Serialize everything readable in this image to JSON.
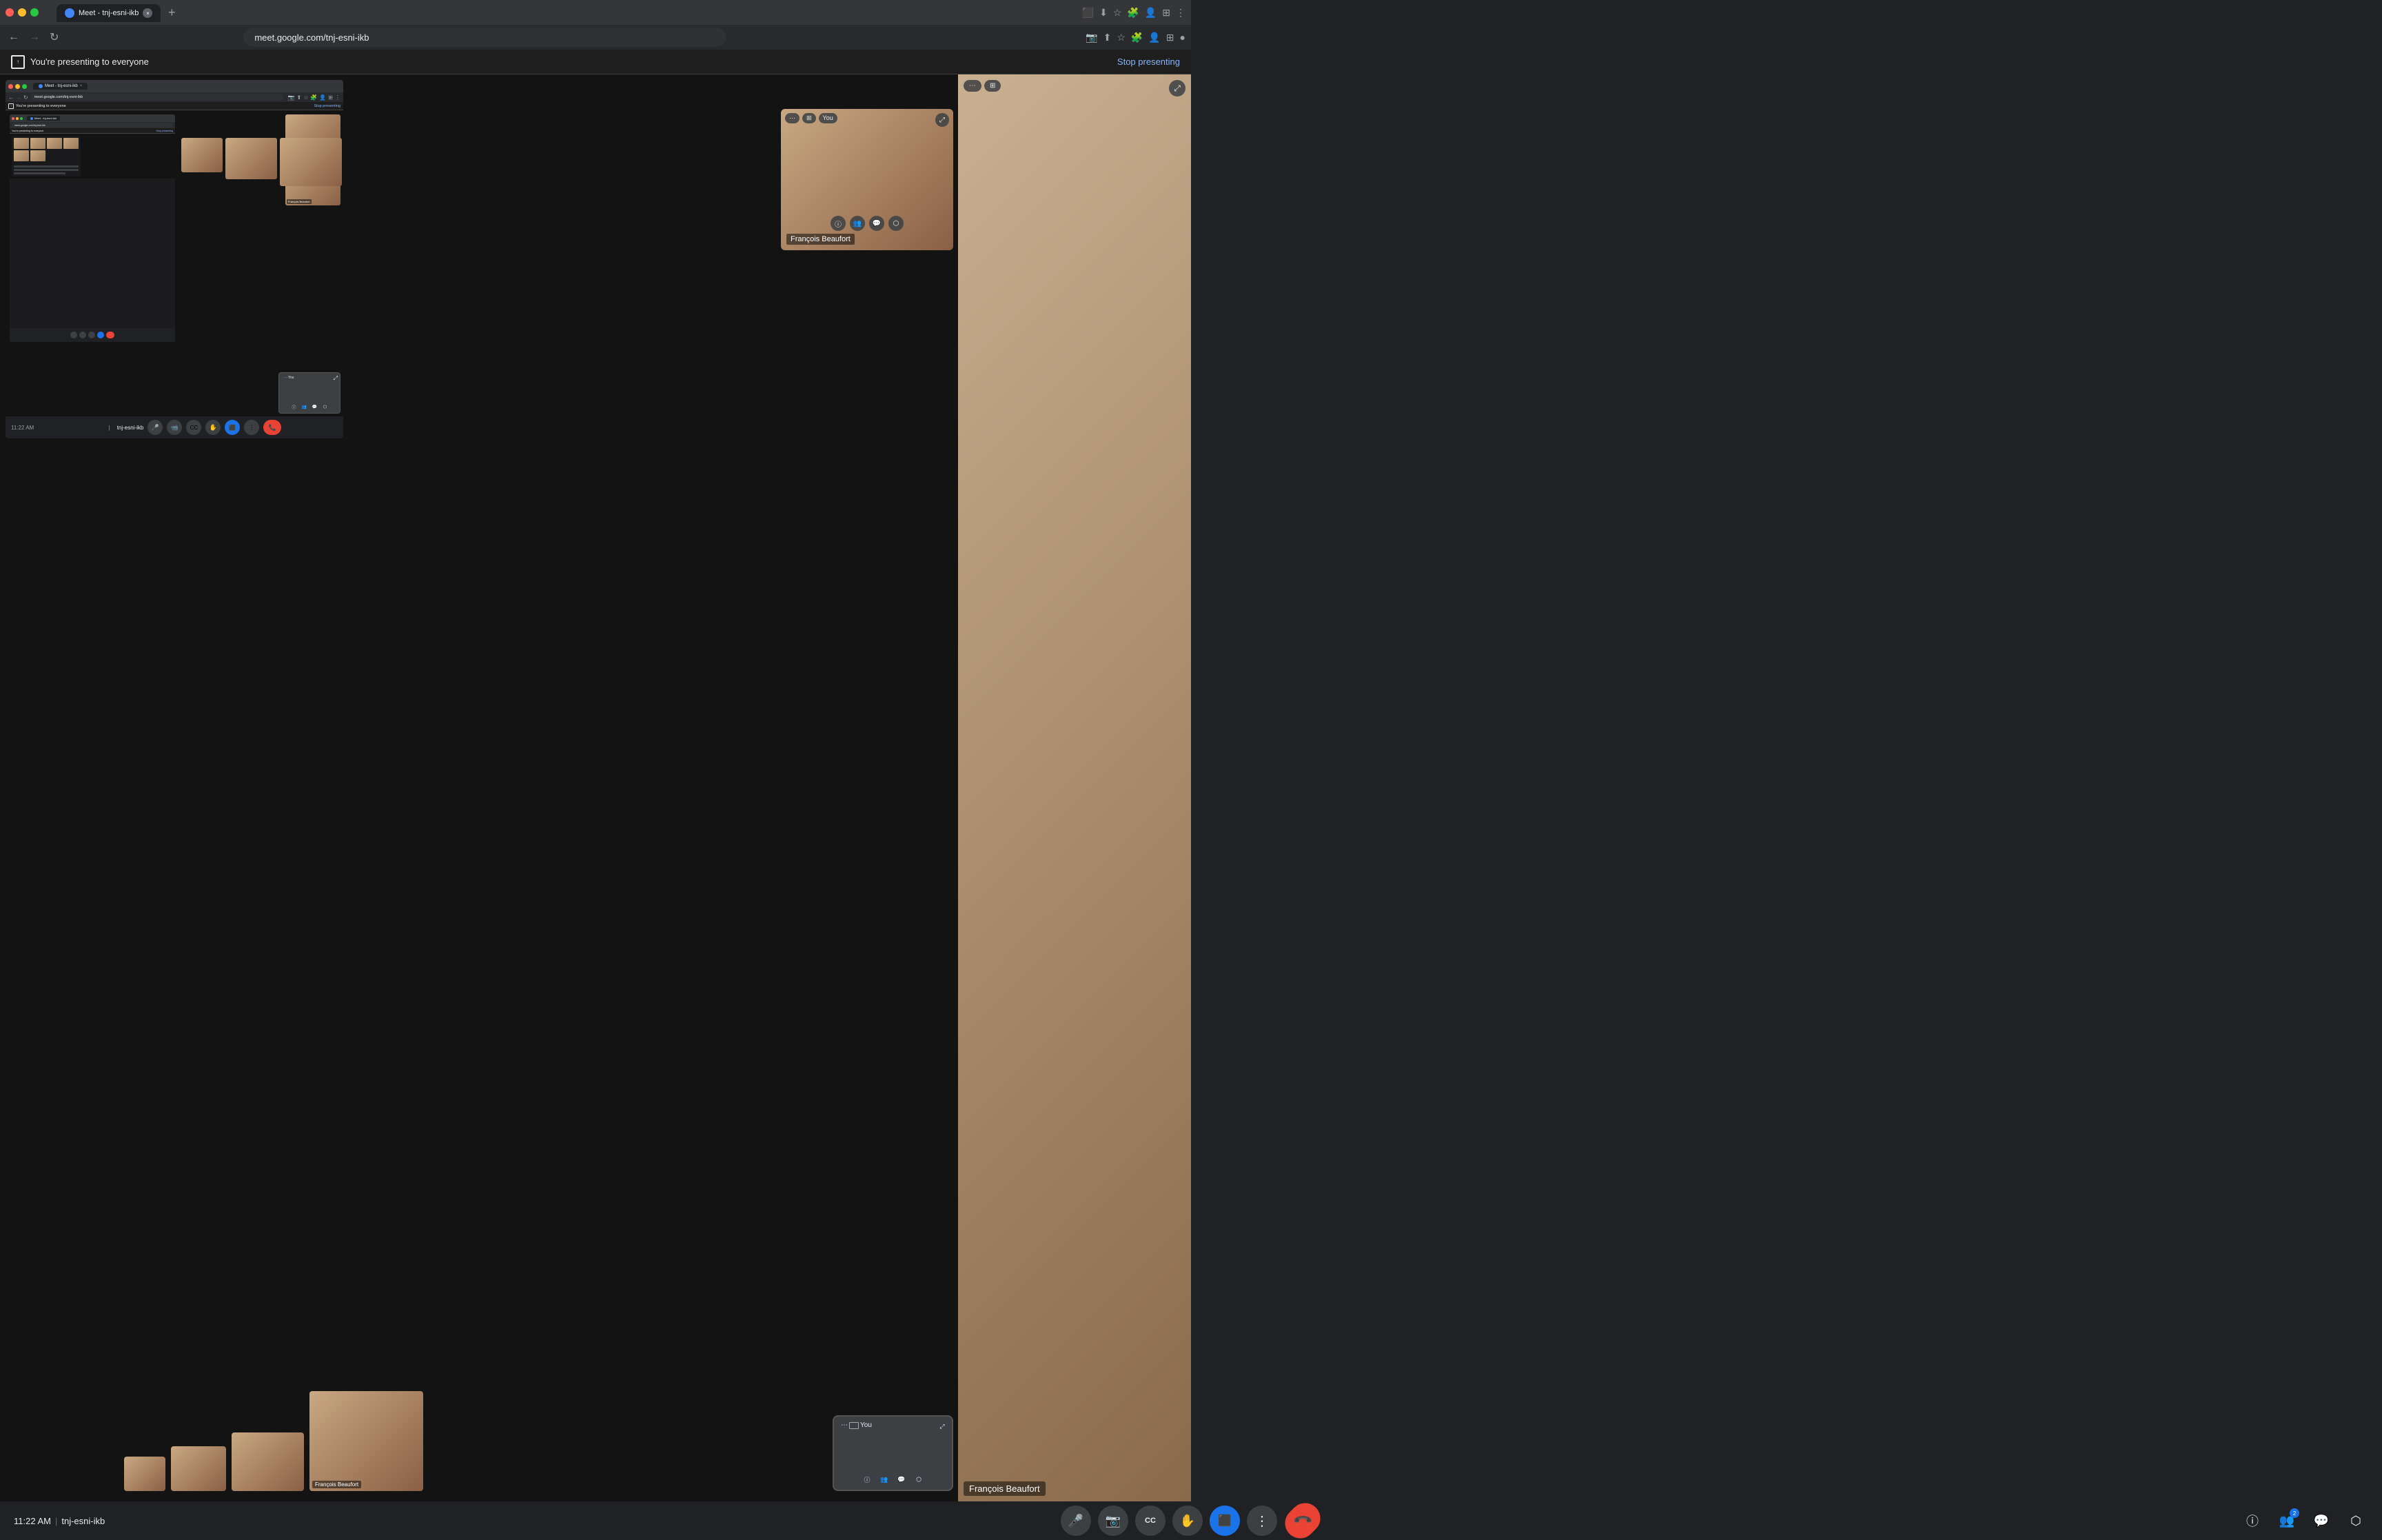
{
  "browser": {
    "tab_title": "Meet - tnj-esni-ikb",
    "tab_new_label": "+",
    "url": "meet.google.com/tnj-esni-ikb",
    "nav_back": "←",
    "nav_forward": "→",
    "nav_reload": "↻"
  },
  "presenting_banner": {
    "icon": "⬛",
    "text": "You're presenting to everyone",
    "stop_btn": "Stop presenting"
  },
  "nested_browser": {
    "tab_title": "Meet - tnj-esni-ikb",
    "url": "meet.google.com/tnj-esni-ikb",
    "presenting_text": "You're presenting to everyone",
    "stop_text": "Stop presenting"
  },
  "participants": {
    "francois_large": {
      "name": "François Beaufort"
    },
    "francois_medium": {
      "name": "François Beaufort"
    },
    "you_label": "You"
  },
  "bottom_toolbar": {
    "time": "11:22 AM",
    "divider": "|",
    "meeting_name": "tnj-esni-ikb",
    "mic_icon": "🎤",
    "camera_icon": "📹",
    "captions_icon": "CC",
    "hand_icon": "✋",
    "present_icon": "⬛",
    "more_icon": "⋮",
    "end_call_icon": "📞",
    "info_icon": "ⓘ",
    "people_icon": "👥",
    "chat_icon": "💬",
    "activities_icon": "⬡",
    "people_badge": "2"
  }
}
